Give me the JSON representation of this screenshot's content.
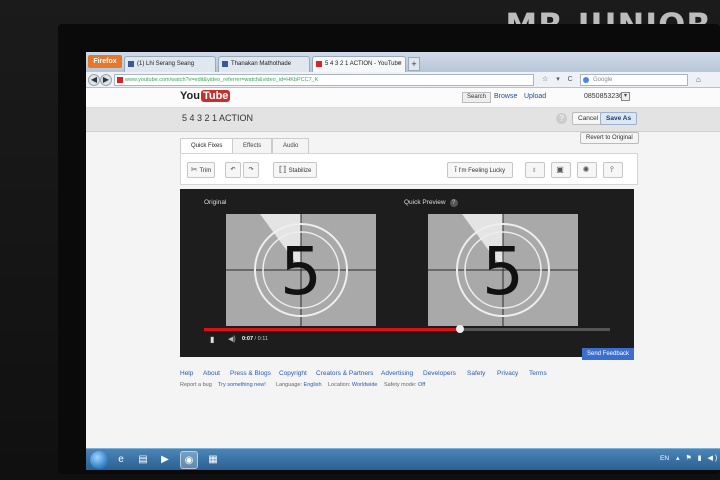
{
  "watermark": "MR.JUNIOR",
  "browser": {
    "app_button": "Firefox",
    "tabs": [
      {
        "label": "(1) Lhi Serang Seang",
        "active": false
      },
      {
        "label": "Thanakan Mathothade",
        "active": false
      },
      {
        "label": "5 4 3 2 1 ACTION - YouTube",
        "active": true
      }
    ],
    "new_tab": "+",
    "tab_close": "×",
    "url": "www.youtube.com/watch?v=edit&video_referrer=watch&video_id=HKbPCC7_K",
    "search_placeholder": "Google",
    "back": "◀",
    "forward": "▶",
    "url_tools": "☆ ▾ C",
    "home": "⌂"
  },
  "youtube": {
    "logo_you": "You",
    "logo_tube": "Tube",
    "search_button": "Search",
    "browse": "Browse",
    "upload": "Upload",
    "user": "0850853236",
    "user_caret": "▾"
  },
  "editor": {
    "title": "5 4 3 2 1 ACTION",
    "help": "?",
    "cancel": "Cancel",
    "save_as": "Save As",
    "revert": "Revert to Original",
    "tabs": [
      "Quick Fixes",
      "Effects",
      "Audio"
    ],
    "tools": {
      "trim": "Trim",
      "rotate_left": "↶",
      "rotate_right": "↷",
      "stabilize": "Stabilize",
      "feeling_lucky": "I'm Feeling Lucky"
    },
    "preview": {
      "original_label": "Original",
      "quick_preview_label": "Quick Preview",
      "info": "?",
      "countdown_digit": "5",
      "current_time": "0:07",
      "duration": "/ 0:11",
      "progress": 0.63
    },
    "send_feedback": "Send Feedback"
  },
  "footer": {
    "links": [
      "Help",
      "About",
      "Press & Blogs",
      "Copyright",
      "Creators & Partners",
      "Advertising",
      "Developers",
      "Safety",
      "Privacy",
      "Terms"
    ],
    "report_bug": "Report a bug",
    "try_new": "Try something new!",
    "language_label": "Language:",
    "language_value": "English",
    "location_label": "Location:",
    "location_value": "Worldwide",
    "safety_label": "Safety mode:",
    "safety_value": "Off"
  },
  "taskbar": {
    "language": "EN"
  }
}
